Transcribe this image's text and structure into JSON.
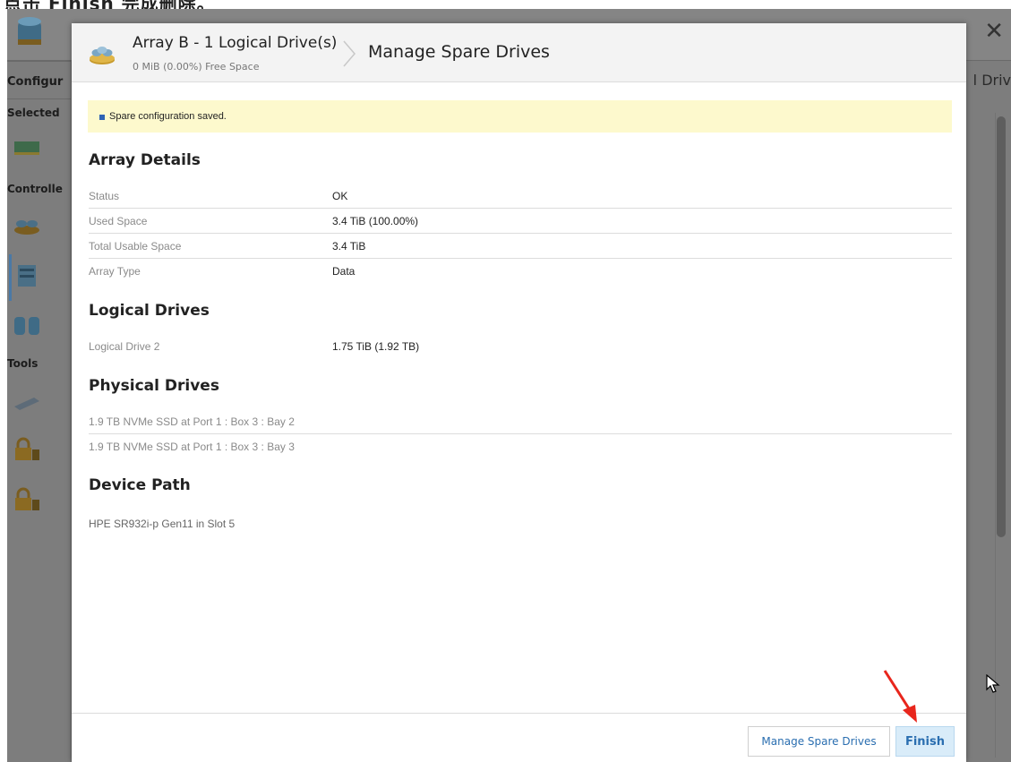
{
  "caption": {
    "text": "点击 Finish 完成删除。"
  },
  "background": {
    "nav_sections": [
      "Configur",
      "Selected",
      "Controlle",
      "Tools"
    ],
    "right_title": "l Driv",
    "close_glyph": "✕"
  },
  "modal": {
    "header": {
      "array_title": "Array B - 1 Logical Drive(s)",
      "array_subtitle": "0 MiB (0.00%) Free Space",
      "page_title": "Manage Spare Drives"
    },
    "notice": "Spare configuration saved.",
    "array_details": {
      "title": "Array Details",
      "rows": [
        {
          "label": "Status",
          "value": "OK"
        },
        {
          "label": "Used Space",
          "value": "3.4 TiB (100.00%)"
        },
        {
          "label": "Total Usable Space",
          "value": "3.4 TiB"
        },
        {
          "label": "Array Type",
          "value": "Data"
        }
      ]
    },
    "logical_drives": {
      "title": "Logical Drives",
      "rows": [
        {
          "label": "Logical Drive 2",
          "value": "1.75 TiB (1.92 TB)"
        }
      ]
    },
    "physical_drives": {
      "title": "Physical Drives",
      "rows": [
        "1.9 TB NVMe SSD at Port 1 : Box 3 : Bay 2",
        "1.9 TB NVMe SSD at Port 1 : Box 3 : Bay 3"
      ]
    },
    "device_path": {
      "title": "Device Path",
      "value": "HPE SR932i-p Gen11 in Slot 5"
    },
    "footer": {
      "secondary_button": "Manage Spare Drives",
      "primary_button": "Finish"
    }
  },
  "colors": {
    "accent": "#2a6eb0",
    "notice_bg": "#fdf9cd",
    "annotation_arrow": "#e8261c",
    "overlay": "#7d7d7d"
  }
}
